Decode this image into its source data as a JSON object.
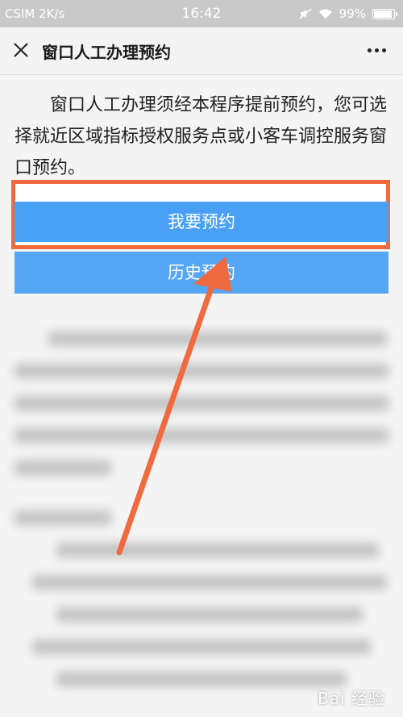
{
  "status": {
    "carrier": "CSIM 2K/s",
    "time": "16:42",
    "battery": "99%",
    "battery_level": 0.99
  },
  "header": {
    "title": "窗口人工办理预约"
  },
  "intro": {
    "text": "窗口人工办理须经本程序提前预约，您可选择就近区域指标授权服务点或小客车调控服务窗口预约。"
  },
  "buttons": {
    "appointment": "我要预约",
    "history": "历史预约"
  },
  "colors": {
    "button_blue": "#49a0f5",
    "highlight": "#ef6a3f"
  },
  "icons": {
    "close": "close-icon",
    "more": "more-dots-icon",
    "signal": "signal-icon",
    "wifi": "wifi-icon",
    "battery": "battery-icon"
  },
  "watermark": "Bai 经验"
}
